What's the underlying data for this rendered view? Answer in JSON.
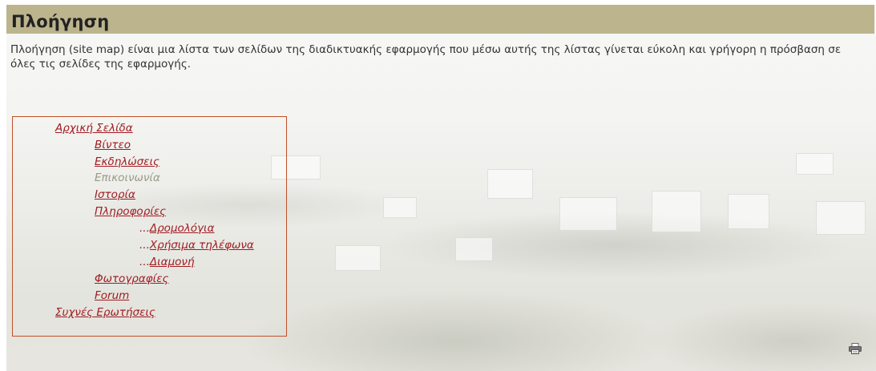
{
  "header": {
    "title": "Πλοήγηση"
  },
  "intro": {
    "text": "Πλοήγηση (site map)  είναι μια λίστα των σελίδων της διαδικτυακής εφαρμογής που μέσω αυτής της λίστας γίνεται εύκολη και γρήγορη η  πρόσβαση σε όλες τις σελίδες της εφαρμογής."
  },
  "sitemap": {
    "home": "Αρχική Σελίδα",
    "video": "Βίντεο",
    "events": "Εκδηλώσεις",
    "contact": "Επικοινωνία",
    "history": "Ιστορία",
    "info": "Πληροφορίες",
    "sub_prefix": "...",
    "routes": "Δρομολόγια",
    "phones": "Χρήσιμα τηλέφωνα",
    "stay": "Διαμονή",
    "photos": "Φωτογραφίες",
    "forum": "Forum",
    "faq": "Συχνές Ερωτήσεις"
  },
  "icons": {
    "print": "printer-icon"
  },
  "colors": {
    "header_bg": "#bcb48d",
    "link": "#a01c22",
    "box_border": "#c0502a",
    "disabled_link": "#9a9a86"
  }
}
